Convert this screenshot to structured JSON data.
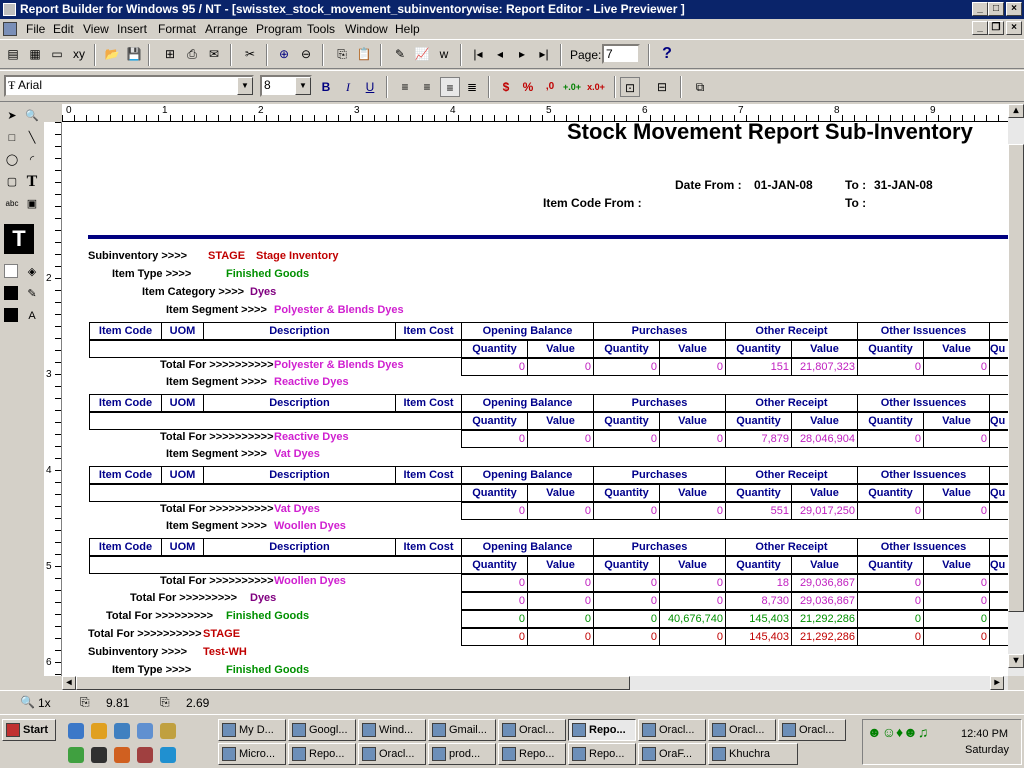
{
  "window": {
    "title": "Report Builder for Windows 95 / NT - [swisstex_stock_movement_subinventorywise: Report Editor - Live Previewer ]"
  },
  "menu": [
    "File",
    "Edit",
    "View",
    "Insert",
    "Format",
    "Arrange",
    "Program",
    "Tools",
    "Window",
    "Help"
  ],
  "toolbar": {
    "page_label": "Page:",
    "page_value": "7",
    "help_icon": "?"
  },
  "format_bar": {
    "font": "Arial",
    "size": "8",
    "bold": "B",
    "italic": "I",
    "underline": "U",
    "currency": "$",
    "percent": "%",
    "comma": ",0",
    "add_decimal": "+.0+",
    "remove_decimal": "x.0+"
  },
  "ruler": [
    "0",
    "1",
    "2",
    "3",
    "4",
    "5",
    "6",
    "7",
    "8",
    "9"
  ],
  "vruler": [
    "2",
    "3",
    "4",
    "5",
    "6"
  ],
  "report": {
    "title": "Stock Movement Report Sub-Inventory",
    "date_from_label": "Date From :",
    "date_from": "01-JAN-08",
    "date_to_label": "To :",
    "date_to": "31-JAN-08",
    "item_code_from_label": "Item Code From :",
    "item_code_to_label": "To :",
    "subinventory_label": "Subinventory >>>>",
    "subinventory_code": "STAGE",
    "subinventory_name": "Stage Inventory",
    "item_type_label": "Item Type >>>>",
    "item_type": "Finished Goods",
    "item_category_label": "Item Category >>>>",
    "item_category": "Dyes",
    "segment_label": "Item Segment >>>>",
    "total_for_label": "Total For >>>>>>>>>>",
    "total_for_short": "Total For >>>>>>>>>",
    "col_headers": [
      "Item Code",
      "UOM",
      "Description",
      "Item Cost"
    ],
    "group_headers": [
      "Opening Balance",
      "Purchases",
      "Other Receipt",
      "Other Issuences"
    ],
    "sub_headers": [
      "Quantity",
      "Value",
      "Quantity",
      "Value",
      "Quantity",
      "Value",
      "Quantity",
      "Value",
      "Qu"
    ],
    "segments": [
      {
        "name": "Polyester & Blends Dyes",
        "totals": [
          "0",
          "0",
          "0",
          "0",
          "151",
          "21,807,323",
          "0",
          "0"
        ]
      },
      {
        "name": "Reactive Dyes",
        "totals": [
          "0",
          "0",
          "0",
          "0",
          "7,879",
          "28,046,904",
          "0",
          "0"
        ]
      },
      {
        "name": "Vat Dyes",
        "totals": [
          "0",
          "0",
          "0",
          "0",
          "551",
          "29,017,250",
          "0",
          "0"
        ]
      },
      {
        "name": "Woollen Dyes",
        "totals": [
          "0",
          "0",
          "0",
          "0",
          "18",
          "29,036,867",
          "0",
          "0"
        ]
      }
    ],
    "category_total": {
      "name": "Dyes",
      "values": [
        "0",
        "0",
        "0",
        "0",
        "8,730",
        "29,036,867",
        "0",
        "0"
      ]
    },
    "type_total": {
      "name": "Finished Goods",
      "values": [
        "0",
        "0",
        "0",
        "40,676,740",
        "145,403",
        "21,292,286",
        "0",
        "0"
      ]
    },
    "sub_total": {
      "name": "STAGE",
      "values": [
        "0",
        "0",
        "0",
        "0",
        "145,403",
        "21,292,286",
        "0",
        "0"
      ]
    },
    "next_subinventory": "Test-WH",
    "next_item_type": "Finished Goods"
  },
  "status": {
    "zoom": "1x",
    "x": "9.81",
    "y": "2.69"
  },
  "taskbar": {
    "start": "Start",
    "row1": [
      "My D...",
      "Googl...",
      "Wind...",
      "Gmail...",
      "Oracl...",
      "Repo...",
      "Oracl...",
      "Oracl...",
      "Oracl..."
    ],
    "row2": [
      "Micro...",
      "Repo...",
      "Oracl...",
      "prod...",
      "Repo...",
      "Repo...",
      "OraF...",
      "Khuchra"
    ],
    "time": "12:40 PM",
    "day": "Saturday"
  }
}
